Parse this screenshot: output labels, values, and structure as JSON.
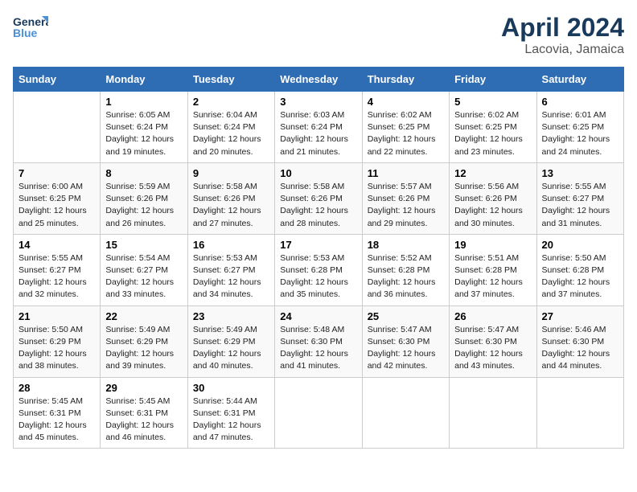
{
  "header": {
    "logo_line1": "General",
    "logo_line2": "Blue",
    "title": "April 2024",
    "subtitle": "Lacovia, Jamaica"
  },
  "calendar": {
    "days_of_week": [
      "Sunday",
      "Monday",
      "Tuesday",
      "Wednesday",
      "Thursday",
      "Friday",
      "Saturday"
    ],
    "weeks": [
      [
        {
          "day": "",
          "info": ""
        },
        {
          "day": "1",
          "info": "Sunrise: 6:05 AM\nSunset: 6:24 PM\nDaylight: 12 hours\nand 19 minutes."
        },
        {
          "day": "2",
          "info": "Sunrise: 6:04 AM\nSunset: 6:24 PM\nDaylight: 12 hours\nand 20 minutes."
        },
        {
          "day": "3",
          "info": "Sunrise: 6:03 AM\nSunset: 6:24 PM\nDaylight: 12 hours\nand 21 minutes."
        },
        {
          "day": "4",
          "info": "Sunrise: 6:02 AM\nSunset: 6:25 PM\nDaylight: 12 hours\nand 22 minutes."
        },
        {
          "day": "5",
          "info": "Sunrise: 6:02 AM\nSunset: 6:25 PM\nDaylight: 12 hours\nand 23 minutes."
        },
        {
          "day": "6",
          "info": "Sunrise: 6:01 AM\nSunset: 6:25 PM\nDaylight: 12 hours\nand 24 minutes."
        }
      ],
      [
        {
          "day": "7",
          "info": "Sunrise: 6:00 AM\nSunset: 6:25 PM\nDaylight: 12 hours\nand 25 minutes."
        },
        {
          "day": "8",
          "info": "Sunrise: 5:59 AM\nSunset: 6:26 PM\nDaylight: 12 hours\nand 26 minutes."
        },
        {
          "day": "9",
          "info": "Sunrise: 5:58 AM\nSunset: 6:26 PM\nDaylight: 12 hours\nand 27 minutes."
        },
        {
          "day": "10",
          "info": "Sunrise: 5:58 AM\nSunset: 6:26 PM\nDaylight: 12 hours\nand 28 minutes."
        },
        {
          "day": "11",
          "info": "Sunrise: 5:57 AM\nSunset: 6:26 PM\nDaylight: 12 hours\nand 29 minutes."
        },
        {
          "day": "12",
          "info": "Sunrise: 5:56 AM\nSunset: 6:26 PM\nDaylight: 12 hours\nand 30 minutes."
        },
        {
          "day": "13",
          "info": "Sunrise: 5:55 AM\nSunset: 6:27 PM\nDaylight: 12 hours\nand 31 minutes."
        }
      ],
      [
        {
          "day": "14",
          "info": "Sunrise: 5:55 AM\nSunset: 6:27 PM\nDaylight: 12 hours\nand 32 minutes."
        },
        {
          "day": "15",
          "info": "Sunrise: 5:54 AM\nSunset: 6:27 PM\nDaylight: 12 hours\nand 33 minutes."
        },
        {
          "day": "16",
          "info": "Sunrise: 5:53 AM\nSunset: 6:27 PM\nDaylight: 12 hours\nand 34 minutes."
        },
        {
          "day": "17",
          "info": "Sunrise: 5:53 AM\nSunset: 6:28 PM\nDaylight: 12 hours\nand 35 minutes."
        },
        {
          "day": "18",
          "info": "Sunrise: 5:52 AM\nSunset: 6:28 PM\nDaylight: 12 hours\nand 36 minutes."
        },
        {
          "day": "19",
          "info": "Sunrise: 5:51 AM\nSunset: 6:28 PM\nDaylight: 12 hours\nand 37 minutes."
        },
        {
          "day": "20",
          "info": "Sunrise: 5:50 AM\nSunset: 6:28 PM\nDaylight: 12 hours\nand 37 minutes."
        }
      ],
      [
        {
          "day": "21",
          "info": "Sunrise: 5:50 AM\nSunset: 6:29 PM\nDaylight: 12 hours\nand 38 minutes."
        },
        {
          "day": "22",
          "info": "Sunrise: 5:49 AM\nSunset: 6:29 PM\nDaylight: 12 hours\nand 39 minutes."
        },
        {
          "day": "23",
          "info": "Sunrise: 5:49 AM\nSunset: 6:29 PM\nDaylight: 12 hours\nand 40 minutes."
        },
        {
          "day": "24",
          "info": "Sunrise: 5:48 AM\nSunset: 6:30 PM\nDaylight: 12 hours\nand 41 minutes."
        },
        {
          "day": "25",
          "info": "Sunrise: 5:47 AM\nSunset: 6:30 PM\nDaylight: 12 hours\nand 42 minutes."
        },
        {
          "day": "26",
          "info": "Sunrise: 5:47 AM\nSunset: 6:30 PM\nDaylight: 12 hours\nand 43 minutes."
        },
        {
          "day": "27",
          "info": "Sunrise: 5:46 AM\nSunset: 6:30 PM\nDaylight: 12 hours\nand 44 minutes."
        }
      ],
      [
        {
          "day": "28",
          "info": "Sunrise: 5:45 AM\nSunset: 6:31 PM\nDaylight: 12 hours\nand 45 minutes."
        },
        {
          "day": "29",
          "info": "Sunrise: 5:45 AM\nSunset: 6:31 PM\nDaylight: 12 hours\nand 46 minutes."
        },
        {
          "day": "30",
          "info": "Sunrise: 5:44 AM\nSunset: 6:31 PM\nDaylight: 12 hours\nand 47 minutes."
        },
        {
          "day": "",
          "info": ""
        },
        {
          "day": "",
          "info": ""
        },
        {
          "day": "",
          "info": ""
        },
        {
          "day": "",
          "info": ""
        }
      ]
    ]
  }
}
